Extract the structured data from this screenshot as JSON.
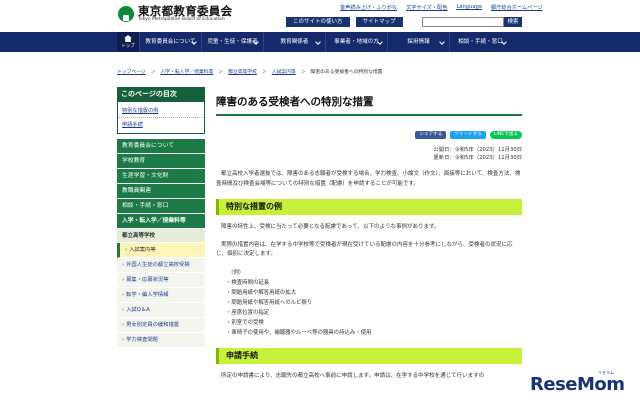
{
  "header": {
    "logo_title": "東京都教育委員会",
    "logo_sub": "Tokyo Metropolitan Board of Education",
    "top_links": [
      "音声読み上げ・ふりがな",
      "文字サイズ・配色",
      "Language",
      "都庁総合ホームページ"
    ],
    "buttons": [
      "このサイトの使い方",
      "サイトマップ"
    ],
    "search_label": "検索",
    "search_placeholder": ""
  },
  "nav": {
    "home_label": "トップ",
    "items": [
      "教育委員会について",
      "児童・生徒・保護者",
      "教育関係者",
      "事業者・地域の方",
      "採用情報",
      "相談・手続・窓口"
    ]
  },
  "breadcrumb": {
    "items": [
      "トップページ",
      "入学・転入学／授業料等",
      "都立高等学校",
      "入試案内等"
    ],
    "current": "障害のある受検者への特別な措置"
  },
  "sidebar": {
    "toc_title": "このページの目次",
    "toc_items": [
      "特別な措置の例",
      "申請手続"
    ],
    "nav_items": [
      "教育委員会について",
      "学校教育",
      "生涯学習・文化財",
      "教職員関連",
      "相談・手続・窓口",
      "入学・転入学／授業料等"
    ],
    "sub_title": "都立高等学校",
    "sub_items": [
      "入試案内等",
      "外国人生徒の都立高校受検",
      "募集・応募状況等",
      "転学・編入学情報",
      "入試Q＆A",
      "男女別定員の緩和措置",
      "学力検査問題"
    ]
  },
  "main": {
    "title": "障害のある受検者への特別な措置",
    "share": {
      "facebook": "シェアする",
      "twitter": "ツイートする",
      "line": "LINEで送る"
    },
    "published": "公開日：令和5年（2023）11月30日",
    "updated": "更新日：令和5年（2023）11月30日",
    "intro": "都立高校入学者選抜では、障害のある志願者が受検する場合、学力検査、小論文（作文）、面接等において、検査方法、検査時間及び検査会場等についての特別な措置（配慮）を申請することが可能です。",
    "section1": "特別な措置の例",
    "s1_p1": "障害の特性上、受検に当たって必要となる配慮であって、以下のような事例があります。",
    "s1_p2": "実際の措置内容は、在学する中学校等で受検者が現在受けている配慮の内容を十分参考にしながら、受検者の状況に応じ、個別に決定します。",
    "example_label": "（例）",
    "examples": [
      "検査時間の延長",
      "問題用紙や解答用紙の拡大",
      "問題用紙や解答用紙へのルビ振り",
      "座席位置の指定",
      "別室での受検",
      "車椅子の使用や、補聴器やルーペ等の器具の持込み・使用"
    ],
    "section2": "申請手続",
    "s2_p1": "所定の申請書により、志願先の都立高校へ事前に申請します。申請は、在学する中学校を通じて行いますの"
  },
  "watermark": {
    "brand": "ReseMom",
    "sub": "リセマム"
  }
}
